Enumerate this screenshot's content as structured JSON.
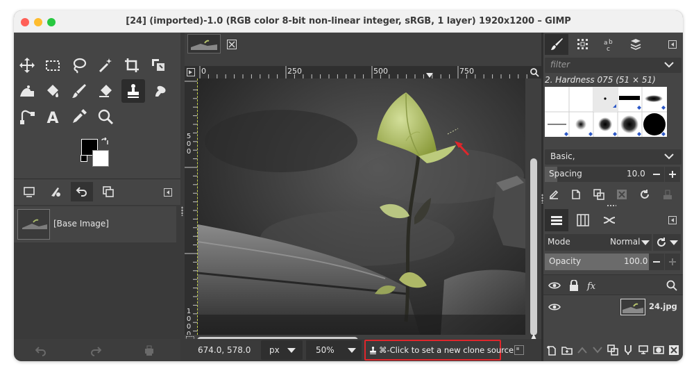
{
  "window": {
    "title": "[24] (imported)-1.0 (RGB color 8-bit non-linear integer, sRGB, 1 layer) 1920x1200 – GIMP"
  },
  "images": {
    "item_label": "[Base Image]"
  },
  "canvas": {
    "ruler_h": [
      "0",
      "250",
      "500",
      "750"
    ],
    "ruler_v_a": [
      "5",
      "0",
      "0"
    ],
    "ruler_v_b": [
      "1",
      "0",
      "0",
      "0"
    ]
  },
  "status": {
    "coords": "674.0, 578.0",
    "unit": "px",
    "zoom": "50%",
    "message": "⌘-Click to set a new clone source"
  },
  "brushes": {
    "filter_placeholder": "filter",
    "selected_name": "2. Hardness 075 (51 × 51)",
    "tag": "Basic,",
    "spacing_label": "Spacing",
    "spacing_value": "10.0"
  },
  "layers": {
    "mode_label": "Mode",
    "mode_value": "Normal",
    "opacity_label": "Opacity",
    "opacity_value": "100.0",
    "layer_name": "24.jpg"
  },
  "colors": {
    "panel_bg": "#454545",
    "accent_red": "#e0262b",
    "titlebar": "#f1f1f1"
  }
}
